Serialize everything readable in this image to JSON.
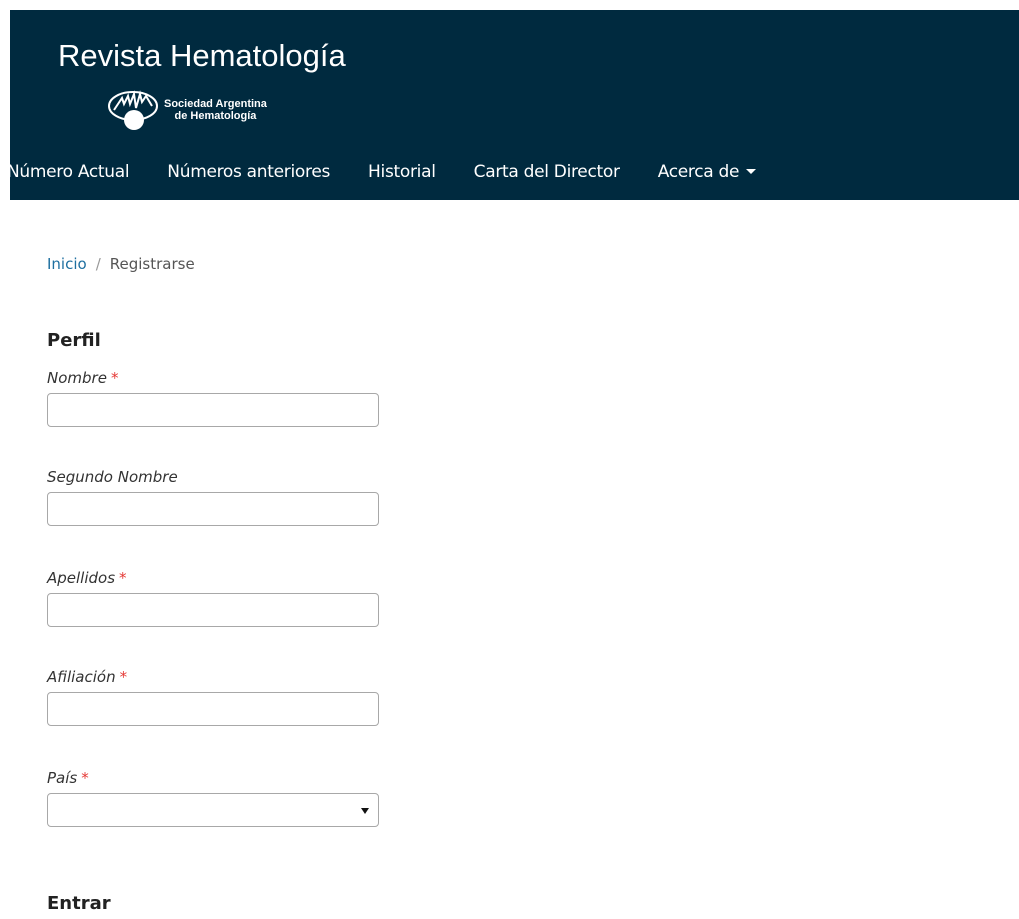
{
  "header": {
    "site_title": "Revista Hematología",
    "logo_line1": "Sociedad Argentina",
    "logo_line2": "de Hematología",
    "logo_icon": "saha-logo-icon"
  },
  "nav": {
    "items": [
      "Número Actual",
      "Números anteriores",
      "Historial",
      "Carta del Director",
      "Acerca de"
    ]
  },
  "breadcrumb": {
    "home": "Inicio",
    "separator": "/",
    "current": "Registrarse"
  },
  "form": {
    "profile_title": "Perfil",
    "fields": [
      {
        "label": "Nombre",
        "required": "*",
        "value": ""
      },
      {
        "label": "Segundo Nombre",
        "required": "",
        "value": ""
      },
      {
        "label": "Apellidos",
        "required": "*",
        "value": ""
      },
      {
        "label": "Afiliación",
        "required": "*",
        "value": ""
      },
      {
        "label": "País",
        "required": "*",
        "value": ""
      }
    ],
    "login_title": "Entrar"
  },
  "colors": {
    "header_bg": "#002a3f",
    "link": "#1e6fa0",
    "required": "#e53935"
  }
}
